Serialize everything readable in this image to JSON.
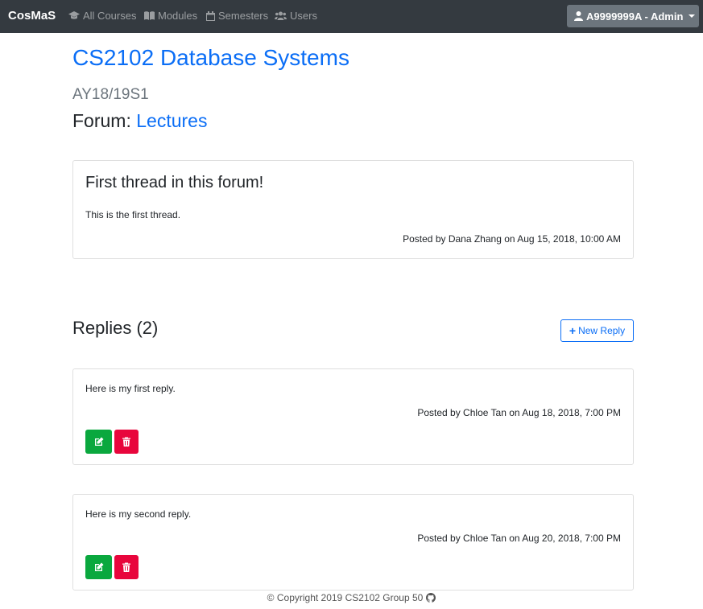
{
  "navbar": {
    "brand": "CosMaS",
    "links": [
      {
        "label": "All Courses",
        "icon": "graduation-cap-icon"
      },
      {
        "label": "Modules",
        "icon": "book-icon"
      },
      {
        "label": "Semesters",
        "icon": "calendar-icon"
      },
      {
        "label": "Users",
        "icon": "users-icon"
      }
    ],
    "user_menu": {
      "label": "A9999999A - Admin",
      "icon": "user-icon"
    }
  },
  "course": {
    "title": "CS2102 Database Systems",
    "semester": "AY18/19S1",
    "forum_prefix": "Forum:",
    "forum_name": "Lectures"
  },
  "thread": {
    "title": "First thread in this forum!",
    "body": "This is the first thread.",
    "meta": "Posted by Dana Zhang on Aug 15, 2018, 10:00 AM"
  },
  "replies_section": {
    "heading": "Replies (2)",
    "new_reply_label": "New Reply"
  },
  "replies": [
    {
      "body": "Here is my first reply.",
      "meta": "Posted by Chloe Tan on Aug 18, 2018, 7:00 PM"
    },
    {
      "body": "Here is my second reply.",
      "meta": "Posted by Chloe Tan on Aug 20, 2018, 7:00 PM"
    }
  ],
  "footer": {
    "text": "© Copyright 2019 CS2102 Group 50",
    "icon": "github-icon"
  },
  "colors": {
    "navbar": "#343a40",
    "link": "#0b6ef6",
    "edit": "#0aa83e",
    "delete": "#e8063c"
  }
}
